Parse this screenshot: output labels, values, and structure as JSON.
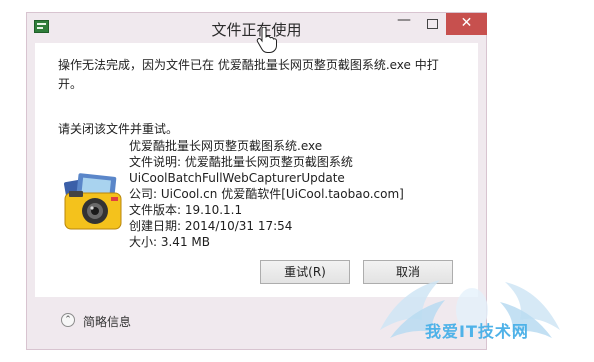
{
  "dialog": {
    "title": "文件正在使用",
    "message": "操作无法完成，因为文件已在 优爱酷批量长网页整页截图系统.exe 中打开。",
    "instruction": "请关闭该文件并重试。",
    "file": {
      "name": "优爱酷批量长网页整页截图系统.exe",
      "description": "文件说明: 优爱酷批量长网页整页截图系统",
      "internal_name": "UiCoolBatchFullWebCapturerUpdate",
      "company": "公司: UiCool.cn 优爱酷软件[UiCool.taobao.com]",
      "version": "文件版本: 19.10.1.1",
      "created": "创建日期: 2014/10/31 17:54",
      "size": "大小: 3.41 MB"
    },
    "buttons": {
      "retry": "重试(R)",
      "cancel": "取消"
    },
    "details_toggle": "简略信息"
  },
  "window_controls": {
    "minimize": "—",
    "close": "✕"
  },
  "watermark": {
    "text": "我爱IT技术网"
  },
  "colors": {
    "close_button": "#c7504e",
    "window_frame": "#f0e9ee",
    "watermark": "#4fb2e8"
  },
  "icons": [
    "app-icon",
    "minimize-icon",
    "maximize-icon",
    "close-icon",
    "file-camera-icon",
    "chevron-up-icon",
    "hand-cursor-icon",
    "watermark-wings-logo"
  ]
}
